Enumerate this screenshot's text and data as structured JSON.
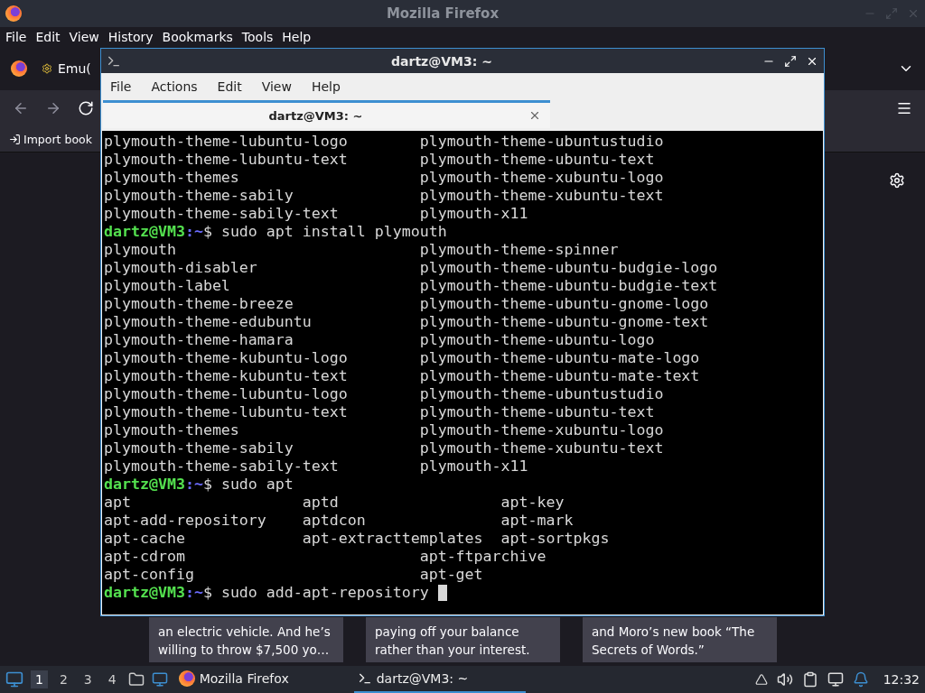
{
  "firefox": {
    "title": "Mozilla Firefox",
    "menu": [
      "File",
      "Edit",
      "View",
      "History",
      "Bookmarks",
      "Tools",
      "Help"
    ],
    "tab": {
      "label": "Emu("
    },
    "bookmark": "Import book",
    "cards": [
      {
        "lines": [
          "an electric vehicle. And he’s",
          "willing to throw $7,500 yo…"
        ]
      },
      {
        "lines": [
          "paying off your balance",
          "rather than your interest."
        ]
      },
      {
        "lines": [
          "and Moro’s new book “The",
          "Secrets of Words.”"
        ]
      }
    ]
  },
  "terminal": {
    "title": "dartz@VM3: ~",
    "menu": [
      "File",
      "Actions",
      "Edit",
      "View",
      "Help"
    ],
    "tab": {
      "label": "dartz@VM3: ~",
      "selected": true
    },
    "lines": [
      {
        "kind": "columns",
        "cells": [
          "plymouth-theme-lubuntu-logo",
          "plymouth-theme-ubuntustudio"
        ]
      },
      {
        "kind": "columns",
        "cells": [
          "plymouth-theme-lubuntu-text",
          "plymouth-theme-ubuntu-text"
        ]
      },
      {
        "kind": "columns",
        "cells": [
          "plymouth-themes",
          "plymouth-theme-xubuntu-logo"
        ]
      },
      {
        "kind": "columns",
        "cells": [
          "plymouth-theme-sabily",
          "plymouth-theme-xubuntu-text"
        ]
      },
      {
        "kind": "columns",
        "cells": [
          "plymouth-theme-sabily-text",
          "plymouth-x11"
        ]
      },
      {
        "kind": "prompt",
        "user": "dartz@VM3",
        "path": ":~",
        "command": "$ sudo apt install plymouth"
      },
      {
        "kind": "columns",
        "cells": [
          "plymouth",
          "plymouth-theme-spinner"
        ]
      },
      {
        "kind": "columns",
        "cells": [
          "plymouth-disabler",
          "plymouth-theme-ubuntu-budgie-logo"
        ]
      },
      {
        "kind": "columns",
        "cells": [
          "plymouth-label",
          "plymouth-theme-ubuntu-budgie-text"
        ]
      },
      {
        "kind": "columns",
        "cells": [
          "plymouth-theme-breeze",
          "plymouth-theme-ubuntu-gnome-logo"
        ]
      },
      {
        "kind": "columns",
        "cells": [
          "plymouth-theme-edubuntu",
          "plymouth-theme-ubuntu-gnome-text"
        ]
      },
      {
        "kind": "columns",
        "cells": [
          "plymouth-theme-hamara",
          "plymouth-theme-ubuntu-logo"
        ]
      },
      {
        "kind": "columns",
        "cells": [
          "plymouth-theme-kubuntu-logo",
          "plymouth-theme-ubuntu-mate-logo"
        ]
      },
      {
        "kind": "columns",
        "cells": [
          "plymouth-theme-kubuntu-text",
          "plymouth-theme-ubuntu-mate-text"
        ]
      },
      {
        "kind": "columns",
        "cells": [
          "plymouth-theme-lubuntu-logo",
          "plymouth-theme-ubuntustudio"
        ]
      },
      {
        "kind": "columns",
        "cells": [
          "plymouth-theme-lubuntu-text",
          "plymouth-theme-ubuntu-text"
        ]
      },
      {
        "kind": "columns",
        "cells": [
          "plymouth-themes",
          "plymouth-theme-xubuntu-logo"
        ]
      },
      {
        "kind": "columns",
        "cells": [
          "plymouth-theme-sabily",
          "plymouth-theme-xubuntu-text"
        ]
      },
      {
        "kind": "columns",
        "cells": [
          "plymouth-theme-sabily-text",
          "plymouth-x11"
        ]
      },
      {
        "kind": "prompt",
        "user": "dartz@VM3",
        "path": ":~",
        "command": "$ sudo apt"
      },
      {
        "kind": "columns",
        "cells": [
          "apt",
          "aptd",
          "apt-key"
        ]
      },
      {
        "kind": "columns",
        "cells": [
          "apt-add-repository",
          "aptdcon",
          "apt-mark"
        ]
      },
      {
        "kind": "columns",
        "cells": [
          "apt-cache",
          "apt-extracttemplates",
          "apt-sortpkgs"
        ]
      },
      {
        "kind": "columns",
        "cells": [
          "apt-cdrom",
          "apt-ftparchive"
        ]
      },
      {
        "kind": "columns",
        "cells": [
          "apt-config",
          "apt-get"
        ]
      },
      {
        "kind": "prompt",
        "user": "dartz@VM3",
        "path": ":~",
        "command": "$ sudo add-apt-repository",
        "cursor": true
      }
    ]
  },
  "taskbar": {
    "workspaces": [
      {
        "label": "1",
        "selected": true
      },
      {
        "label": "2",
        "selected": false
      },
      {
        "label": "3",
        "selected": false
      },
      {
        "label": "4",
        "selected": false
      }
    ],
    "tasks": [
      {
        "kind": "browser",
        "label": "Mozilla Firefox",
        "selected": false
      },
      {
        "kind": "terminal",
        "label": "dartz@VM3: ~",
        "selected": true
      }
    ],
    "clock": "12:32"
  }
}
